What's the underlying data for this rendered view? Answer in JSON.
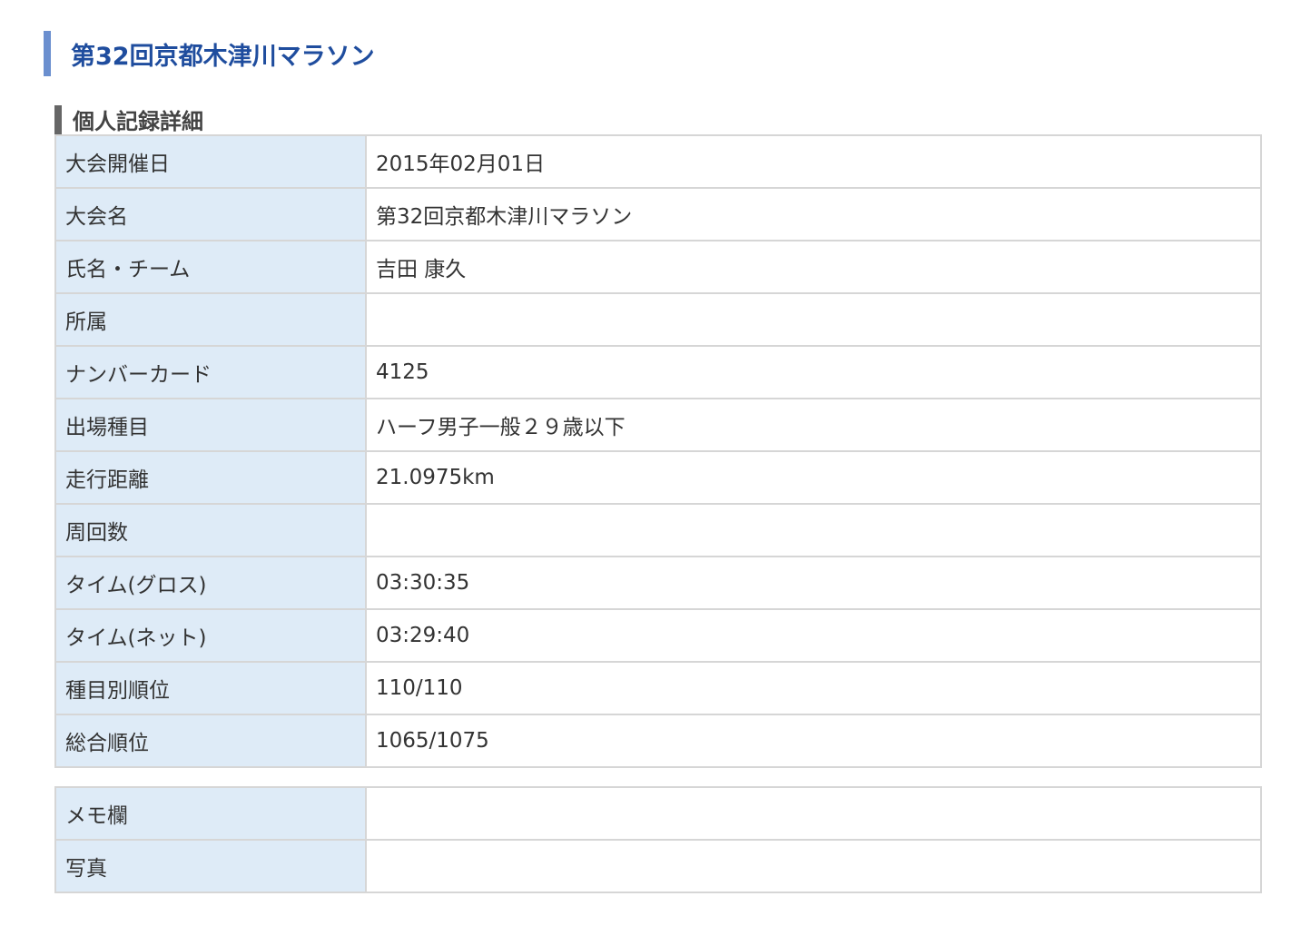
{
  "page_title": "第32回京都木津川マラソン",
  "section_title": "個人記録詳細",
  "record_rows": [
    {
      "label": "大会開催日",
      "value": "2015年02月01日"
    },
    {
      "label": "大会名",
      "value": "第32回京都木津川マラソン"
    },
    {
      "label": "氏名・チーム",
      "value": "吉田 康久"
    },
    {
      "label": "所属",
      "value": ""
    },
    {
      "label": "ナンバーカード",
      "value": "4125"
    },
    {
      "label": "出場種目",
      "value": "ハーフ男子一般２９歳以下"
    },
    {
      "label": "走行距離",
      "value": "21.0975km"
    },
    {
      "label": "周回数",
      "value": ""
    },
    {
      "label": "タイム(グロス)",
      "value": "03:30:35"
    },
    {
      "label": "タイム(ネット)",
      "value": "03:29:40"
    },
    {
      "label": "種目別順位",
      "value": "110/110"
    },
    {
      "label": "総合順位",
      "value": "1065/1075"
    }
  ],
  "extra_rows": [
    {
      "label": "メモ欄",
      "value": ""
    },
    {
      "label": "写真",
      "value": ""
    }
  ],
  "colors": {
    "title_text": "#1f4d9e",
    "title_bar": "#6b8fcf",
    "section_bar": "#666666",
    "label_bg": "#deebf7",
    "border": "#d6d6d6"
  }
}
